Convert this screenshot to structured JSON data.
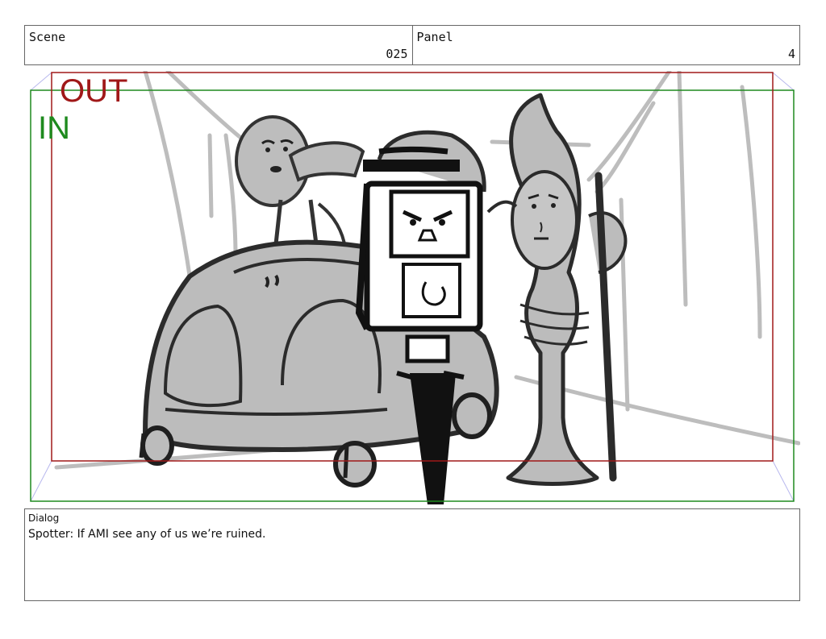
{
  "header": {
    "scene_label": "Scene",
    "scene_value": "025",
    "panel_label": "Panel",
    "panel_value": "4"
  },
  "frame": {
    "in_label": "IN",
    "out_label": "OUT",
    "in_color": "#1e8a1e",
    "out_color": "#a01818"
  },
  "dialog": {
    "label": "Dialog",
    "text": "Spotter: If AMI see any of us we’re ruined."
  }
}
